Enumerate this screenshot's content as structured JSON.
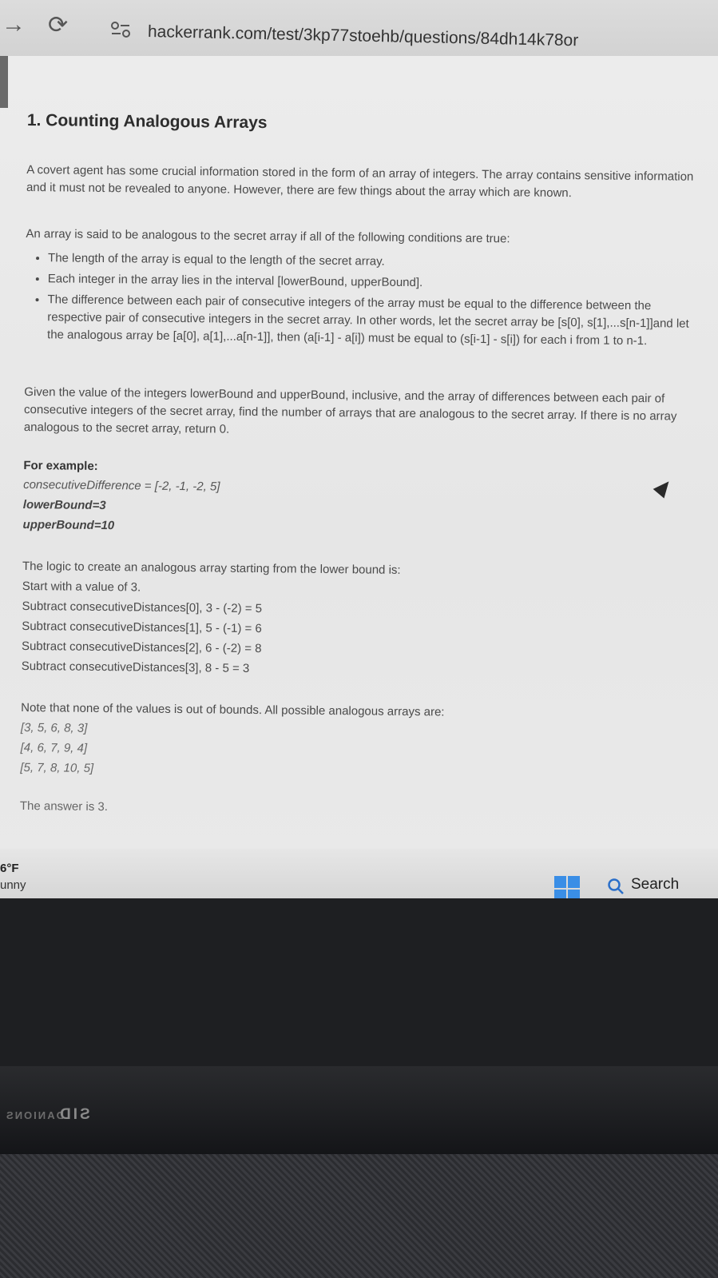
{
  "browser": {
    "url": "hackerrank.com/test/3kp77stoehb/questions/84dh14k78or",
    "forward_icon": "→",
    "reload_icon": "⟳"
  },
  "problem": {
    "title": "1. Counting Analogous Arrays",
    "intro": "A covert agent has some crucial information stored in the form of an array of integers. The array contains sensitive information and it must not be revealed to anyone. However, there are few things about the array which are known.",
    "conditions_lead": "An array is said to be analogous to the secret array if all of the following conditions are true:",
    "conditions": [
      "The length of the array is equal to the length of the secret array.",
      "Each integer in the array lies in the interval [lowerBound, upperBound].",
      "The difference between each pair of consecutive integers of the array must be equal to the difference between the respective pair of consecutive integers in the secret array. In other words, let the secret array be [s[0], s[1],...s[n-1]]and let the analogous array be [a[0], a[1],...a[n-1]], then (a[i-1] - a[i]) must be equal to (s[i-1] - s[i]) for each i from 1 to n-1."
    ],
    "question": "Given the value of the integers lowerBound and upperBound, inclusive, and the array of differences between each pair of consecutive integers of the secret array, find the number of arrays that are analogous to the secret array. If there is no array analogous to the secret array, return 0.",
    "example_heading": "For example:",
    "example_lines": [
      "consecutiveDifference = [-2, -1, -2, 5]",
      "lowerBound=3",
      "upperBound=10"
    ],
    "logic_lines": [
      "The logic to create an analogous array starting from the lower bound is:",
      "Start with a value of 3.",
      "Subtract consecutiveDistances[0], 3 - (-2) = 5",
      "Subtract consecutiveDistances[1], 5 - (-1) = 6",
      "Subtract consecutiveDistances[2], 6 - (-2) = 8",
      "Subtract consecutiveDistances[3], 8 - 5 = 3"
    ],
    "note": "Note that none of the values is out of bounds. All possible analogous arrays are:",
    "arrays": [
      "[3, 5, 6, 8, 3]",
      "[4, 6, 7, 9, 4]",
      "[5, 7, 8, 10, 5]"
    ],
    "answer": "The answer is 3."
  },
  "taskbar": {
    "temperature": "6°F",
    "condition": "unny",
    "search_label": "Search"
  },
  "laptop": {
    "brand_small": "DANIONS",
    "brand_large": "SID"
  },
  "colors": {
    "win_blue": "#3a8ee6"
  }
}
